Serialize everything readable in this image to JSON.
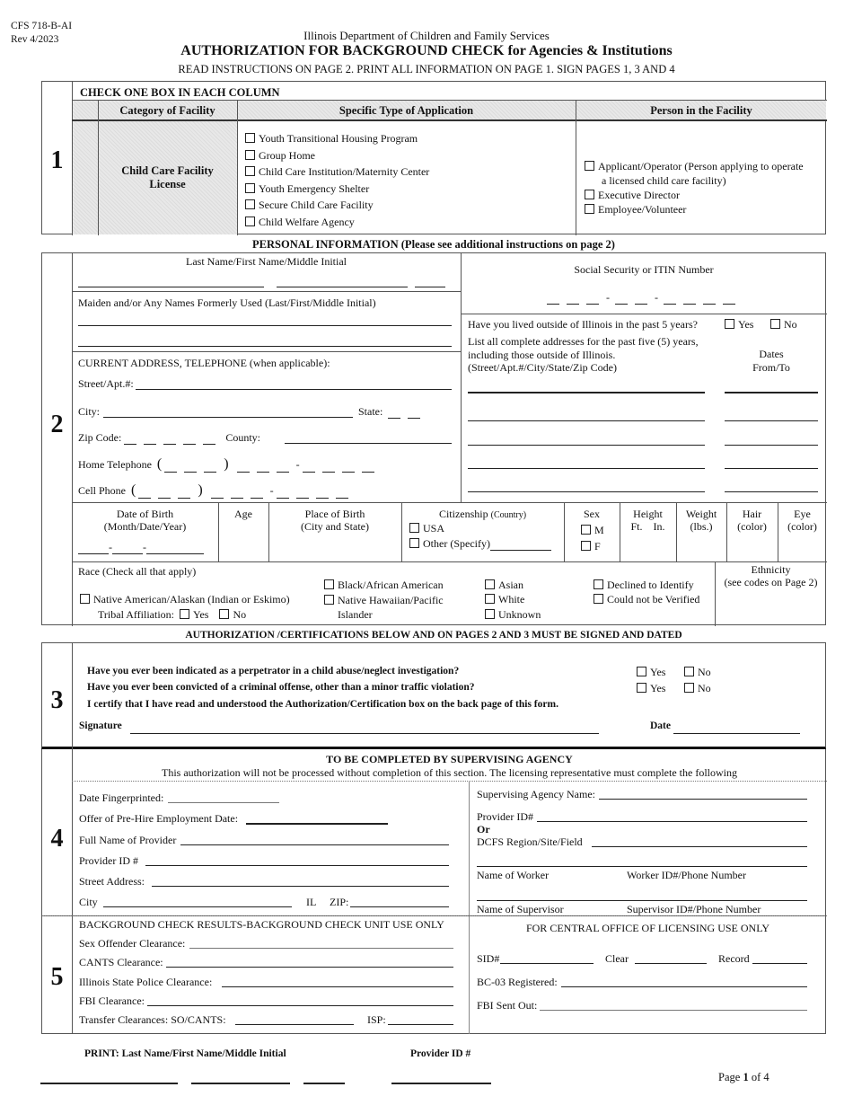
{
  "header": {
    "form_number": "CFS 718-B-AI",
    "revision": "Rev 4/2023",
    "agency": "Illinois Department of Children and Family Services",
    "title": "AUTHORIZATION FOR BACKGROUND CHECK for Agencies & Institutions",
    "instructions": "READ INSTRUCTIONS ON PAGE 2. PRINT ALL INFORMATION ON PAGE 1.  SIGN PAGES 1, 3 AND 4"
  },
  "section1": {
    "number": "1",
    "heading": "CHECK ONE BOX IN EACH COLUMN",
    "col_category": "Category of Facility",
    "col_type": "Specific Type of Application",
    "col_person": "Person in the Facility",
    "category_value_line1": "Child Care Facility",
    "category_value_line2": "License",
    "application_types": [
      "Youth Transitional Housing Program",
      "Group Home",
      "Child Care Institution/Maternity Center",
      "Youth Emergency Shelter",
      "Secure Child Care Facility",
      "Child Welfare Agency"
    ],
    "person_options": [
      "Applicant/Operator (Person applying to operate",
      "Executive Director",
      "Employee/Volunteer"
    ],
    "person_option0_line2": "a licensed child care facility)"
  },
  "section2": {
    "number": "2",
    "heading": "PERSONAL INFORMATION (Please see additional instructions on page 2)",
    "name_label": "Last Name/First Name/Middle Initial",
    "maiden_label": "Maiden and/or Any Names Formerly Used (Last/First/Middle Initial)",
    "address_heading": "CURRENT ADDRESS, TELEPHONE (when applicable):",
    "street_label": "Street/Apt.#:",
    "city_label": "City:",
    "state_label": "State:",
    "zip_label": "Zip Code:",
    "county_label": "County:",
    "home_phone_label": "Home Telephone",
    "cell_phone_label": "Cell Phone",
    "ssn_label": "Social Security or ITIN Number",
    "lived_outside_q": "Have you lived outside of Illinois in the past 5 years?",
    "yes": "Yes",
    "no": "No",
    "addresses_instr1": "List all complete addresses for the past five (5) years,",
    "addresses_instr2": "including those outside of Illinois.",
    "addresses_instr3": "(Street/Apt.#/City/State/Zip Code)",
    "dates_label1": "Dates",
    "dates_label2": "From/To",
    "dob_label1": "Date of Birth",
    "dob_label2": "(Month/Date/Year)",
    "age_label": "Age",
    "pob_label1": "Place of Birth",
    "pob_label2": "(City and State)",
    "citizenship_label": "Citizenship",
    "citizenship_sub": "(Country)",
    "citizenship_usa": "USA",
    "citizenship_other": "Other (Specify)",
    "sex_label": "Sex",
    "sex_m": "M",
    "sex_f": "F",
    "height_label1": "Height",
    "height_label2": "Ft.    In.",
    "weight_label1": "Weight",
    "weight_label2": "(lbs.)",
    "hair_label1": "Hair",
    "hair_label2": "(color)",
    "eye_label1": "Eye",
    "eye_label2": "(color)",
    "race_label": "Race (Check all that apply)",
    "race_native": "Native American/Alaskan (Indian or Eskimo)",
    "tribal_label": "Tribal Affiliation:",
    "race_black": "Black/African American",
    "race_hawaiian1": "Native Hawaiian/Pacific",
    "race_hawaiian2": "Islander",
    "race_asian": "Asian",
    "race_white": "White",
    "race_unknown": "Unknown",
    "race_declined": "Declined to Identify",
    "race_not_verified": "Could not be Verified",
    "ethnicity_label1": "Ethnicity",
    "ethnicity_label2": "(see codes on Page 2)"
  },
  "section3": {
    "number": "3",
    "heading": "AUTHORIZATION /CERTIFICATIONS BELOW AND ON PAGES 2 AND 3 MUST BE SIGNED AND DATED",
    "q1": "Have you ever been indicated as a perpetrator in a child abuse/neglect investigation?",
    "q2": "Have you ever been convicted of a criminal offense, other than a minor traffic violation?",
    "certify": "I certify that I have read and understood the Authorization/Certification box on the back page of this form.",
    "yes": "Yes",
    "no": "No",
    "signature_label": "Signature",
    "date_label": "Date"
  },
  "section4": {
    "number": "4",
    "heading": "TO BE COMPLETED BY SUPERVISING AGENCY",
    "subheading": "This authorization will not be processed without completion of this section. The licensing representative  must complete the following",
    "date_fingerprinted": "Date Fingerprinted:",
    "offer_date": "Offer of Pre-Hire Employment Date:",
    "provider_name": "Full Name of Provider",
    "provider_id": "Provider ID #",
    "street_address": "Street Address:",
    "city": "City",
    "state_fixed": "IL",
    "zip": "ZIP:",
    "agency_name": "Supervising Agency Name:",
    "agency_provider_id": "Provider ID#",
    "or": "Or",
    "dcfs_region": "DCFS Region/Site/Field",
    "worker_name": "Name of Worker",
    "worker_id": "Worker ID#/Phone Number",
    "supervisor_name": "Name of Supervisor",
    "supervisor_id": "Supervisor ID#/Phone Number"
  },
  "section5": {
    "number": "5",
    "heading": "BACKGROUND CHECK RESULTS-BACKGROUND CHECK UNIT USE ONLY",
    "sex_offender": "Sex Offender Clearance:",
    "cants": "CANTS Clearance:",
    "isp": "Illinois State Police Clearance:",
    "fbi": "FBI Clearance:",
    "transfer": "Transfer Clearances:  SO/CANTS:",
    "transfer_isp": "ISP:",
    "central_heading": "FOR CENTRAL OFFICE OF LICENSING USE ONLY",
    "sid": "SID#",
    "clear": "Clear",
    "record": "Record",
    "bc03": "BC-03 Registered:",
    "fbi_sent": "FBI Sent Out:"
  },
  "footer": {
    "print_label": "PRINT:  Last Name/First Name/Middle Initial",
    "provider_id_label": "Provider ID #",
    "page_prefix": "Page ",
    "page_current": "1",
    "page_suffix": " of 4"
  }
}
